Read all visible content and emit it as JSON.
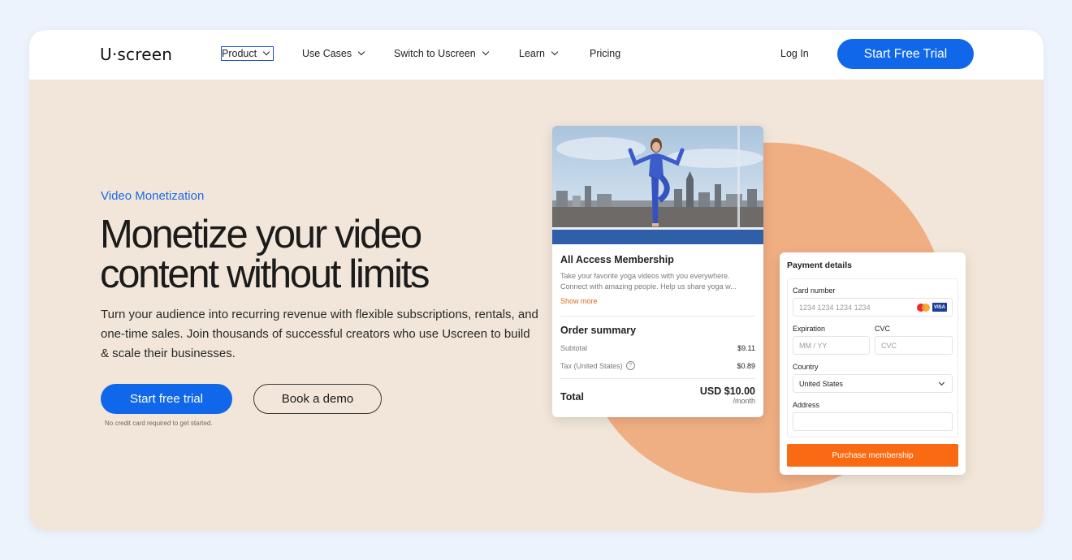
{
  "nav": {
    "logo": "U·screen",
    "items": [
      {
        "label": "Product"
      },
      {
        "label": "Use Cases"
      },
      {
        "label": "Switch to Uscreen"
      },
      {
        "label": "Learn"
      },
      {
        "label": "Pricing"
      }
    ],
    "login": "Log In",
    "cta": "Start Free Trial"
  },
  "hero": {
    "eyebrow": "Video Monetization",
    "headline_line1": "Monetize your video",
    "headline_line2": "content without limits",
    "subhead": "Turn your audience into recurring revenue with flexible subscriptions, rentals, and one-time sales. Join thousands of successful creators who use Uscreen to build & scale their businesses.",
    "primary_cta": "Start free trial",
    "secondary_cta": "Book a demo",
    "note": "No credit card required to get started."
  },
  "membership": {
    "title": "All Access Membership",
    "desc_line1": "Take your favorite yoga videos with you everywhere.",
    "desc_line2": "Connect with amazing people. Help us share yoga w...",
    "show_more": "Show more",
    "order_title": "Order summary",
    "subtotal_label": "Subtotal",
    "subtotal_value": "$9.11",
    "tax_label": "Tax (United States)",
    "tax_value": "$0.89",
    "total_label": "Total",
    "total_value": "USD $10.00",
    "total_period": "/month"
  },
  "payment": {
    "title": "Payment details",
    "card_number_label": "Card number",
    "card_number_placeholder": "1234 1234 1234 1234",
    "visa_text": "VISA",
    "expiration_label": "Expiration",
    "expiration_placeholder": "MM / YY",
    "cvc_label": "CVC",
    "cvc_placeholder": "CVC",
    "country_label": "Country",
    "country_value": "United States",
    "address_label": "Address",
    "address_value": "",
    "purchase_button": "Purchase membership"
  },
  "colors": {
    "brand_blue": "#1167ea",
    "hero_bg": "#f1e6d9",
    "blob": "#f0ae83",
    "purchase_orange": "#fa6a12"
  }
}
